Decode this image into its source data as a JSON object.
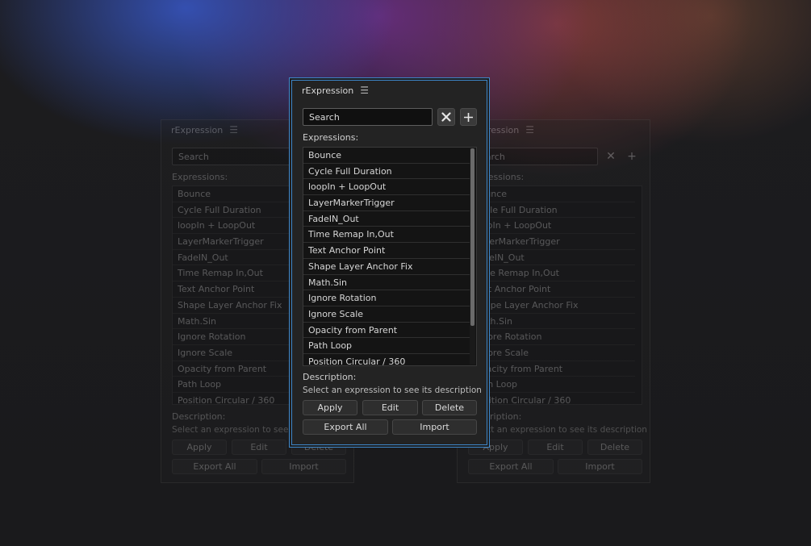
{
  "panel": {
    "title": "rExpression",
    "search_placeholder": "Search",
    "expressions_label": "Expressions:",
    "description_label": "Description:",
    "description_text": "Select an expression to see its description",
    "buttons": {
      "apply": "Apply",
      "edit": "Edit",
      "delete": "Delete",
      "export_all": "Export All",
      "import": "Import"
    },
    "expressions": [
      "Bounce",
      "Cycle Full Duration",
      "loopIn + LoopOut",
      "LayerMarkerTrigger",
      "FadeIN_Out",
      "Time Remap In,Out",
      "Text Anchor Point",
      "Shape Layer Anchor Fix",
      "Math.Sin",
      "Ignore Rotation",
      "Ignore Scale",
      "Opacity from Parent",
      "Path Loop",
      "Position Circular / 360"
    ]
  },
  "icons": {
    "menu": "hamburger-icon",
    "clear": "close-icon",
    "add": "plus-icon"
  },
  "colors": {
    "focus_border": "#3d86c8",
    "panel_bg": "#232323"
  }
}
